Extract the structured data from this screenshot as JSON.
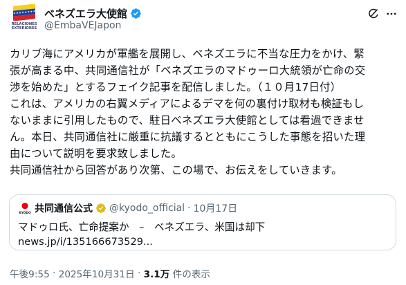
{
  "author": {
    "display_name": "ベネズエラ大使館",
    "handle": "@EmbaVEJapon",
    "avatar_org_text": "RELACIONES EXTERIORES",
    "avatar_stars": "★★★★★★★★",
    "verified": true
  },
  "tweet": {
    "text": "カリブ海にアメリカが軍艦を展開し、ベネズエラに不当な圧力をかけ、緊\n張が高まる中、共同通信社が「ベネズエラのマドゥーロ大統領が亡命の交\n渉を始めた」とするフェイク記事を配信しました。（１０月17日付）\nこれは、アメリカの右翼メディアによるデマを何の裏付け取材も検証もし\nないままに引用したもので、駐日ベネズエラ大使館としては看過できませ\nん。本日、共同通信社に厳重に抗議するとともにこうした事態を招いた理\n由について説明を要求致しました。\n共同通信社から回答があり次第、この場で、お伝えをしていきます。"
  },
  "quote": {
    "avatar_text": "KYODO",
    "display_name": "共同通信公式",
    "handle": "@kyodo_official",
    "separator": "·",
    "date": "10月17日",
    "text": "マドゥロ氏、亡命提案か　–　ベネズエラ、米国は却下\nnews.jp/i/135166673529..."
  },
  "meta": {
    "time": "午後9:55",
    "separator": " · ",
    "date": "2025年10月31日",
    "views_count": "3.1万",
    "views_label": " 件の表示"
  },
  "colors": {
    "text": "#0f1419",
    "secondary": "#536471",
    "verified": "#1d9bf0",
    "kyodo_red": "#e60012",
    "border": "#cfd9de"
  },
  "icons": [
    "verified-badge-icon",
    "grok-icon",
    "more-icon"
  ]
}
